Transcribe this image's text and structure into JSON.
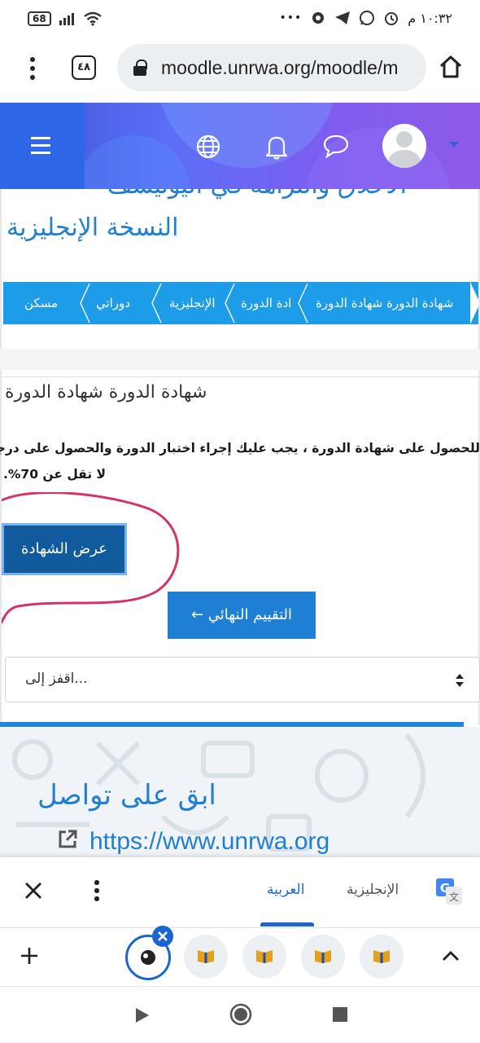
{
  "status_bar": {
    "battery": "68",
    "time": "١٠:٣٢ م",
    "dots": "•••"
  },
  "browser": {
    "url": "moodle.unrwa.org/moodle/m",
    "tab_count": "٤٨"
  },
  "page": {
    "title_line1": "الأخلاق والنزاهة في اليونيسف -",
    "title_line2": "النسخة الإنجليزية",
    "breadcrumb": [
      "شهادة الدورة شهادة الدورة",
      "ادة الدورة",
      "الإنجليزية",
      "دوراتي",
      "مسكن"
    ],
    "card_title": "شهادة الدورة شهادة الدورة",
    "paragraph_line1": "للحصول على شهادة الدورة ، يجب عليك إجراء اختبار الدورة والحصول على درجة",
    "paragraph_line2": "لا تقل عن 70%.",
    "view_certificate_label": "عرض الشهادة",
    "next_activity_label": "التقييم النهائي ←",
    "jump_placeholder": "...اقفز إلى"
  },
  "footer": {
    "stay_in_touch": "ابق على تواصل",
    "link": "https://www.unrwa.org"
  },
  "translate_bar": {
    "target_lang": "العربية",
    "source_lang": "الإنجليزية",
    "accent": "#1a66cc"
  },
  "colors": {
    "header_gradient_start": "#3a56d8",
    "header_gradient_end": "#8e5be8",
    "breadcrumb_bg": "#1d9ce8",
    "primary_button": "#1f7fd3",
    "certificate_button": "#115a9e",
    "annotation_ink": "#d2346a"
  },
  "icons": [
    "globe-icon",
    "bell-icon",
    "chat-icon",
    "user-avatar-icon",
    "home-icon",
    "lock-icon",
    "external-link-icon",
    "google-translate-icon"
  ]
}
